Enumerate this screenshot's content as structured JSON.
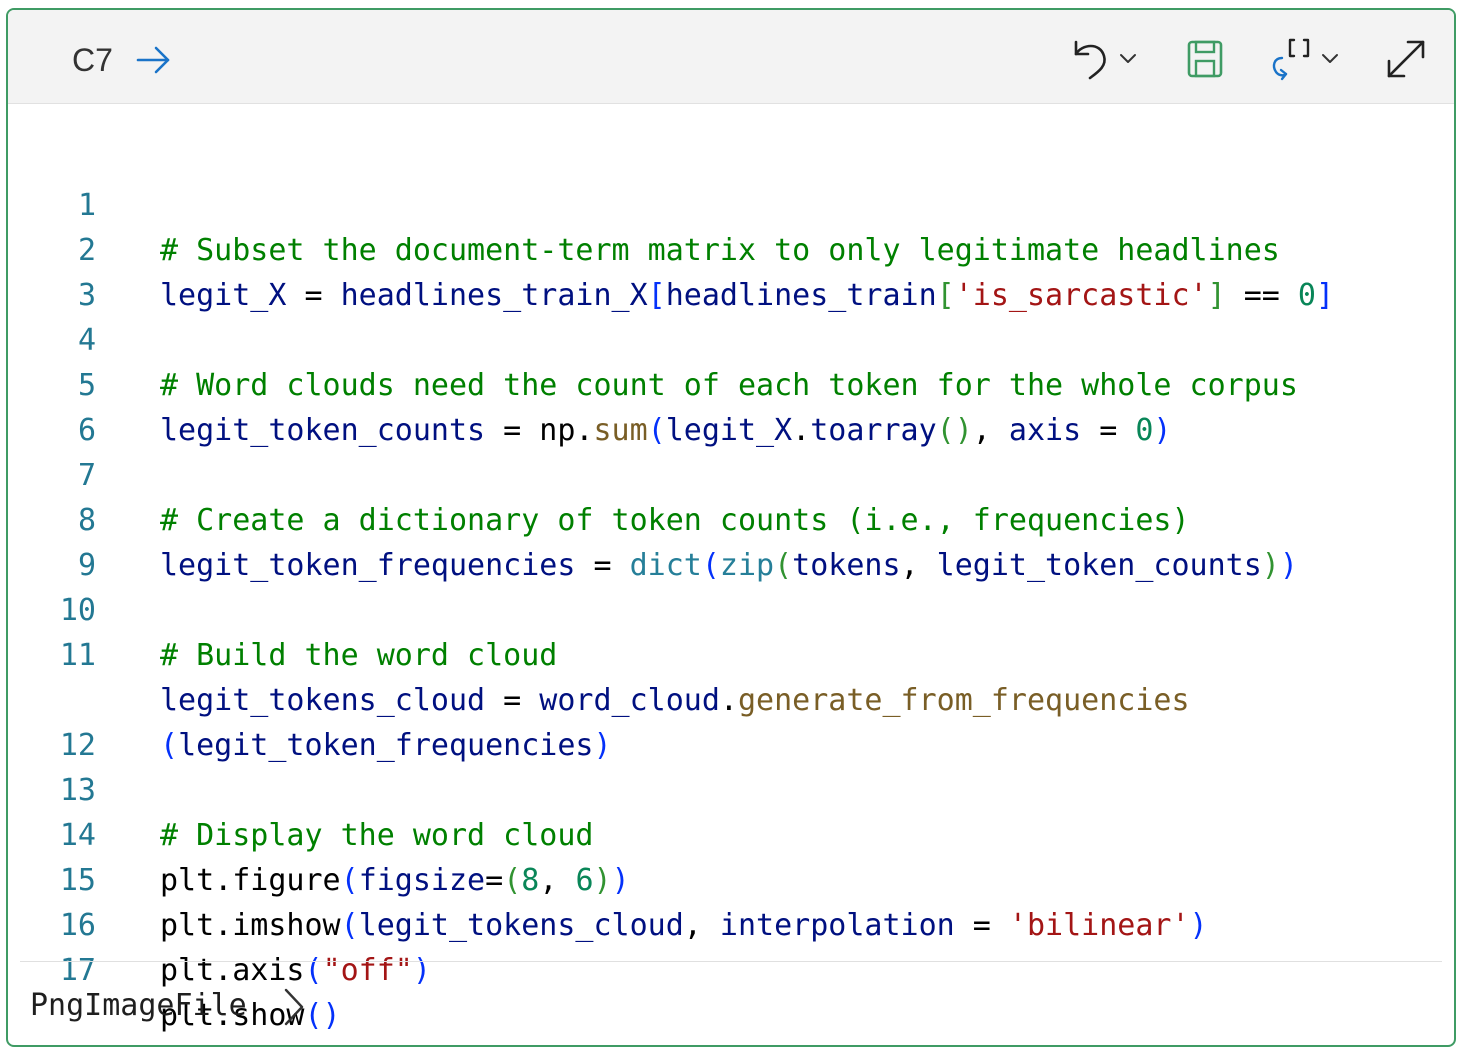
{
  "cell": {
    "id": "C7",
    "toolbar": {
      "undo": "undo-icon",
      "save": "save-icon",
      "variables": "variable-explorer-icon",
      "expand": "expand-icon"
    }
  },
  "code_lines": [
    {
      "n": "1"
    },
    {
      "n": "2"
    },
    {
      "n": "3"
    },
    {
      "n": "4"
    },
    {
      "n": "5"
    },
    {
      "n": "6"
    },
    {
      "n": "7"
    },
    {
      "n": "8"
    },
    {
      "n": "9"
    },
    {
      "n": "10"
    },
    {
      "n": "11"
    },
    {
      "n": "12"
    },
    {
      "n": "13"
    },
    {
      "n": "14"
    },
    {
      "n": "15"
    },
    {
      "n": "16"
    },
    {
      "n": "17"
    }
  ],
  "code": {
    "l1": "# Subset the document-term matrix to only legitimate headlines",
    "l2": {
      "a": "legit_X",
      "b": " = ",
      "c": "headlines_train_X",
      "d": "[",
      "e": "headlines_train",
      "f": "[",
      "g": "'is_sarcastic'",
      "h": "]",
      "i": " == ",
      "j": "0",
      "k": "]"
    },
    "l4": "# Word clouds need the count of each token for the whole corpus",
    "l5": {
      "a": "legit_token_counts",
      "b": " = ",
      "c": "np",
      "d": ".",
      "e": "sum",
      "f": "(",
      "g": "legit_X",
      "h": ".",
      "i": "toarray",
      "j": "()",
      "k": ", ",
      "l": "axis",
      "m": " = ",
      "n": "0",
      "o": ")"
    },
    "l7": "# Create a dictionary of token counts (i.e., frequencies)",
    "l8": {
      "a": "legit_token_frequencies",
      "b": " = ",
      "c": "dict",
      "d": "(",
      "e": "zip",
      "f": "(",
      "g": "tokens",
      "h": ", ",
      "i": "legit_token_counts",
      "j": ")",
      "k": ")"
    },
    "l10": "# Build the word cloud",
    "l11": {
      "a": "legit_tokens_cloud",
      "b": " = ",
      "c": "word_cloud",
      "d": ".",
      "e": "generate_from_frequencies",
      "f": "(",
      "g": "legit_token_frequencies",
      "h": ")"
    },
    "l13": "# Display the word cloud",
    "l14": {
      "a": "plt",
      "b": ".",
      "c": "figure",
      "d": "(",
      "e": "figsize",
      "f": "=",
      "g": "(",
      "h": "8",
      "i": ", ",
      "j": "6",
      "k": ")",
      "l": ")"
    },
    "l15": {
      "a": "plt",
      "b": ".",
      "c": "imshow",
      "d": "(",
      "e": "legit_tokens_cloud",
      "f": ", ",
      "g": "interpolation",
      "h": " = ",
      "i": "'bilinear'",
      "j": ")"
    },
    "l16": {
      "a": "plt",
      "b": ".",
      "c": "axis",
      "d": "(",
      "e": "\"off\"",
      "f": ")"
    },
    "l17": {
      "a": "plt",
      "b": ".",
      "c": "show",
      "d": "()"
    }
  },
  "output": {
    "label": "PngImageFile"
  },
  "colors": {
    "border": "#3f9b64",
    "comment": "#008000",
    "variable": "#001080",
    "function": "#795e26",
    "builtin": "#267f99",
    "number": "#098658",
    "string": "#a31515",
    "line_number": "#237893"
  }
}
